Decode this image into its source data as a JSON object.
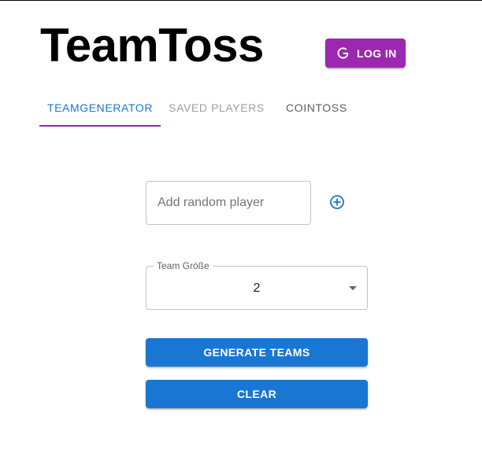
{
  "app": {
    "title": "TeamToss"
  },
  "header": {
    "login_label": "LOG IN",
    "login_icon": "google-icon"
  },
  "tabs": [
    {
      "label": "TEAMGENERATOR",
      "active": true
    },
    {
      "label": "SAVED PLAYERS",
      "active": false,
      "disabled": true
    },
    {
      "label": "COINTOSS",
      "active": false
    }
  ],
  "player_input": {
    "value": "",
    "placeholder": "Add random player",
    "add_icon": "plus-circle-icon"
  },
  "team_size": {
    "label": "Team Größe",
    "selected": "2",
    "icon": "dropdown-arrow-icon"
  },
  "actions": {
    "generate_label": "GENERATE TEAMS",
    "clear_label": "CLEAR"
  },
  "colors": {
    "primary": "#1976d2",
    "secondary": "#9c27b0",
    "disabled_text": "#9e9e9e",
    "border": "#c4c4c4"
  }
}
